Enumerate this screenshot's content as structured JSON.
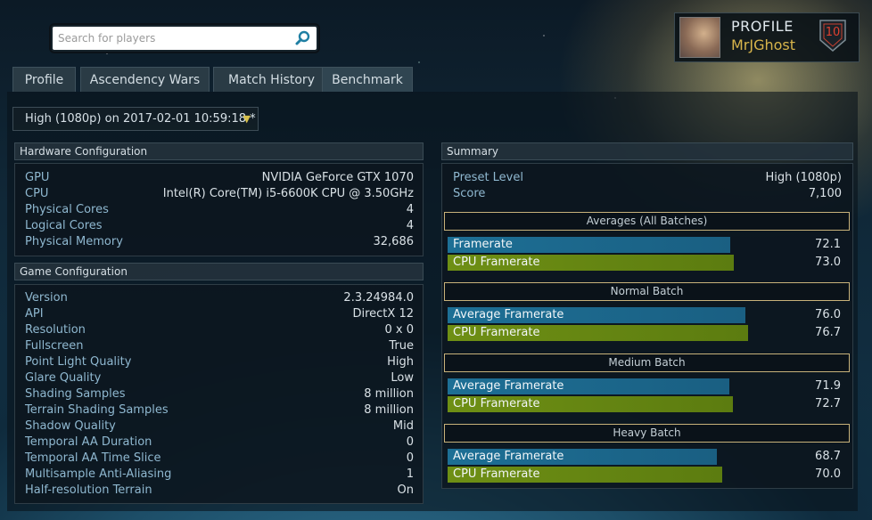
{
  "search": {
    "placeholder": "Search for players"
  },
  "profile": {
    "label": "PROFILE",
    "name": "MrJGhost",
    "level": "10"
  },
  "tabs": [
    "Profile",
    "Ascendency Wars",
    "Match History",
    "Benchmark"
  ],
  "run_selector": {
    "value": "High (1080p) on 2017-02-01 10:59:18 *"
  },
  "hardware": {
    "title": "Hardware Configuration",
    "rows": [
      {
        "key": "GPU",
        "value": "NVIDIA GeForce GTX 1070"
      },
      {
        "key": "CPU",
        "value": "Intel(R) Core(TM) i5-6600K CPU @ 3.50GHz"
      },
      {
        "key": "Physical Cores",
        "value": "4"
      },
      {
        "key": "Logical Cores",
        "value": "4"
      },
      {
        "key": "Physical Memory",
        "value": "32,686"
      }
    ]
  },
  "game": {
    "title": "Game Configuration",
    "rows": [
      {
        "key": "Version",
        "value": "2.3.24984.0"
      },
      {
        "key": "API",
        "value": "DirectX 12"
      },
      {
        "key": "Resolution",
        "value": "0 x 0"
      },
      {
        "key": "Fullscreen",
        "value": "True"
      },
      {
        "key": "Point Light Quality",
        "value": "High"
      },
      {
        "key": "Glare Quality",
        "value": "Low"
      },
      {
        "key": "Shading Samples",
        "value": "8 million"
      },
      {
        "key": "Terrain Shading Samples",
        "value": "8 million"
      },
      {
        "key": "Shadow Quality",
        "value": "Mid"
      },
      {
        "key": "Temporal AA Duration",
        "value": "0"
      },
      {
        "key": "Temporal AA Time Slice",
        "value": "0"
      },
      {
        "key": "Multisample Anti-Aliasing",
        "value": "1"
      },
      {
        "key": "Half-resolution Terrain",
        "value": "On"
      }
    ]
  },
  "summary": {
    "title": "Summary",
    "rows": [
      {
        "key": "Preset Level",
        "value": "High (1080p)"
      },
      {
        "key": "Score",
        "value": "7,100"
      }
    ],
    "batches": [
      {
        "title": "Averages (All Batches)",
        "bars": [
          {
            "label": "Framerate",
            "value": "72.1",
            "num": 72.1,
            "color": "blue"
          },
          {
            "label": "CPU Framerate",
            "value": "73.0",
            "num": 73.0,
            "color": "green"
          }
        ]
      },
      {
        "title": "Normal Batch",
        "bars": [
          {
            "label": "Average Framerate",
            "value": "76.0",
            "num": 76.0,
            "color": "blue"
          },
          {
            "label": "CPU Framerate",
            "value": "76.7",
            "num": 76.7,
            "color": "green"
          }
        ]
      },
      {
        "title": "Medium Batch",
        "bars": [
          {
            "label": "Average Framerate",
            "value": "71.9",
            "num": 71.9,
            "color": "blue"
          },
          {
            "label": "CPU Framerate",
            "value": "72.7",
            "num": 72.7,
            "color": "green"
          }
        ]
      },
      {
        "title": "Heavy Batch",
        "bars": [
          {
            "label": "Average Framerate",
            "value": "68.7",
            "num": 68.7,
            "color": "blue"
          },
          {
            "label": "CPU Framerate",
            "value": "70.0",
            "num": 70.0,
            "color": "green"
          }
        ]
      }
    ]
  }
}
